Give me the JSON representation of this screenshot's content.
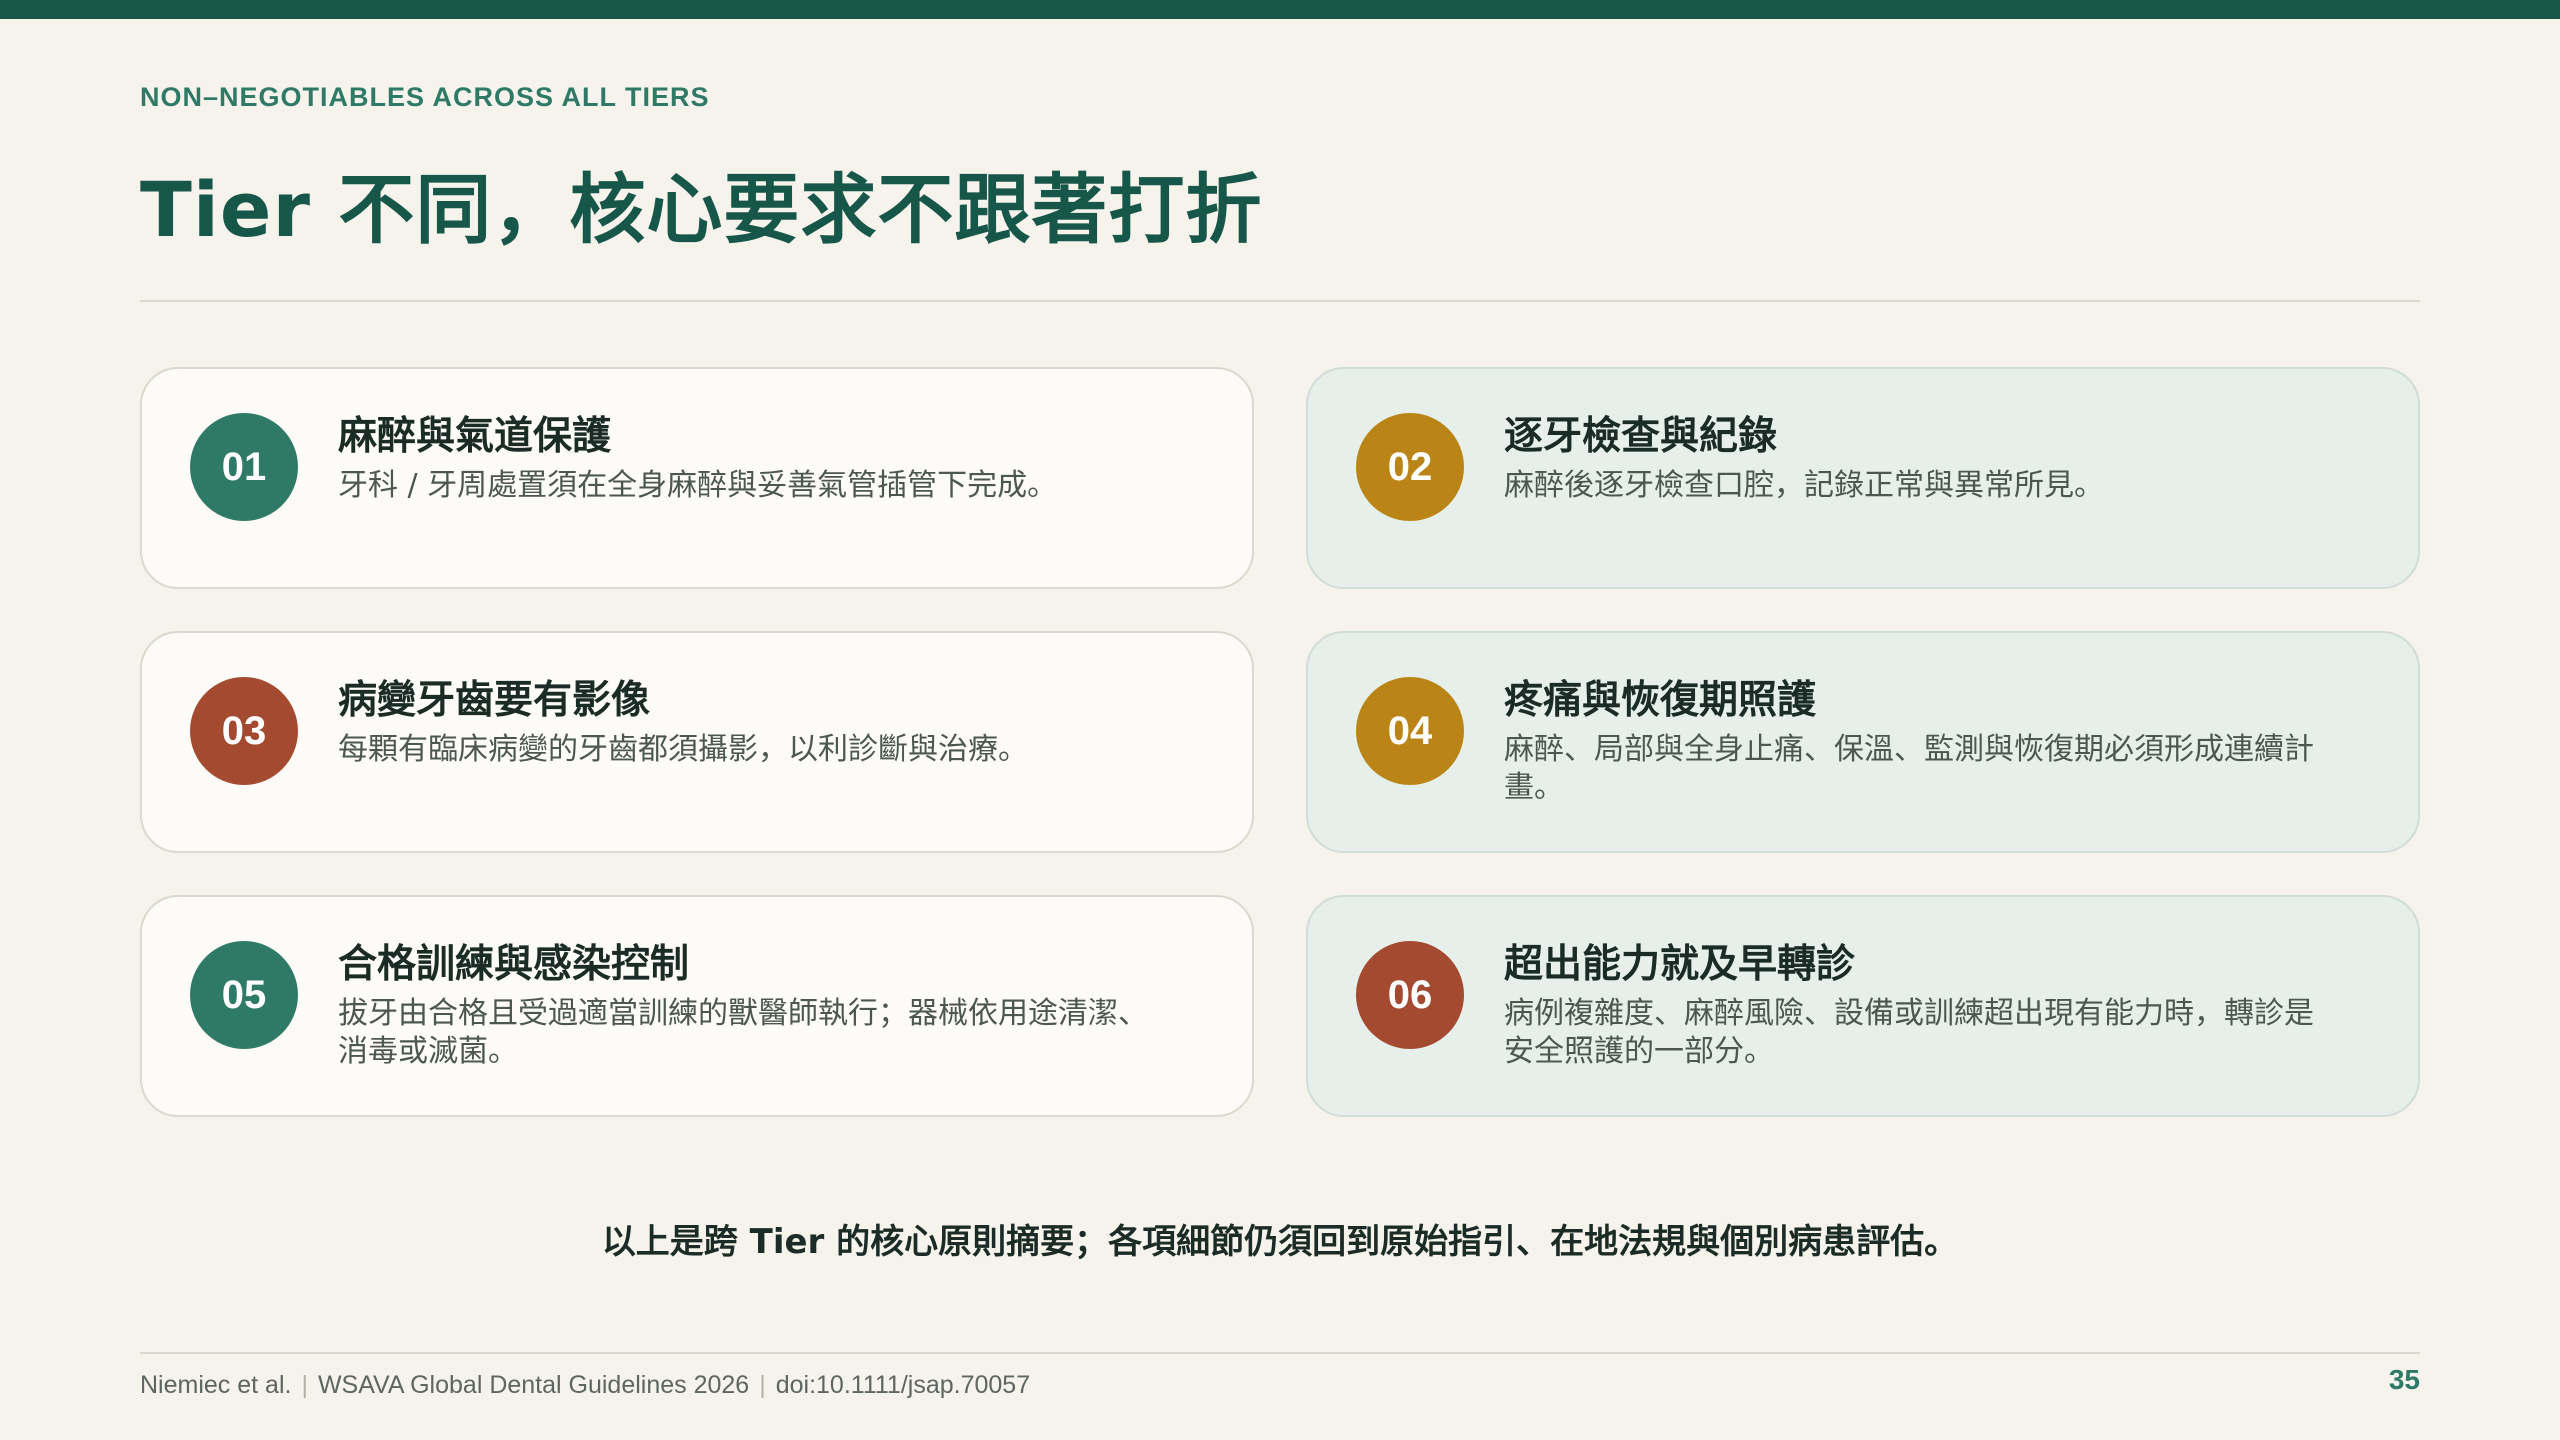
{
  "header": {
    "eyebrow": "NON–NEGOTIABLES ACROSS ALL TIERS",
    "title": "Tier 不同，核心要求不跟著打折"
  },
  "colors": {
    "accent": "#17574a",
    "teal": "#2f7a67",
    "gold": "#ba8516",
    "rust": "#a34a31"
  },
  "cards": [
    {
      "number": "01",
      "title": "麻醉與氣道保護",
      "desc": "牙科 / 牙周處置須在全身麻醉與妥善氣管插管下完成。",
      "color": "#2f7a67"
    },
    {
      "number": "02",
      "title": "逐牙檢查與紀錄",
      "desc": "麻醉後逐牙檢查口腔，記錄正常與異常所見。",
      "color": "#ba8516"
    },
    {
      "number": "03",
      "title": "病變牙齒要有影像",
      "desc": "每顆有臨床病變的牙齒都須攝影，以利診斷與治療。",
      "color": "#a34a31"
    },
    {
      "number": "04",
      "title": "疼痛與恢復期照護",
      "desc": "麻醉、局部與全身止痛、保溫、監測與恢復期必須形成連續計畫。",
      "color": "#ba8516"
    },
    {
      "number": "05",
      "title": "合格訓練與感染控制",
      "desc": "拔牙由合格且受過適當訓練的獸醫師執行；器械依用途清潔、消毒或滅菌。",
      "color": "#2f7a67"
    },
    {
      "number": "06",
      "title": "超出能力就及早轉診",
      "desc": "病例複雜度、麻醉風險、設備或訓練超出現有能力時，轉診是安全照護的一部分。",
      "color": "#a34a31"
    }
  ],
  "summary": "以上是跨 Tier 的核心原則摘要；各項細節仍須回到原始指引、在地法規與個別病患評估。",
  "footer": {
    "authors": "Niemiec et al.",
    "guideline": "WSAVA Global Dental Guidelines 2026",
    "doi": "doi:10.1111/jsap.70057",
    "page": "35"
  }
}
